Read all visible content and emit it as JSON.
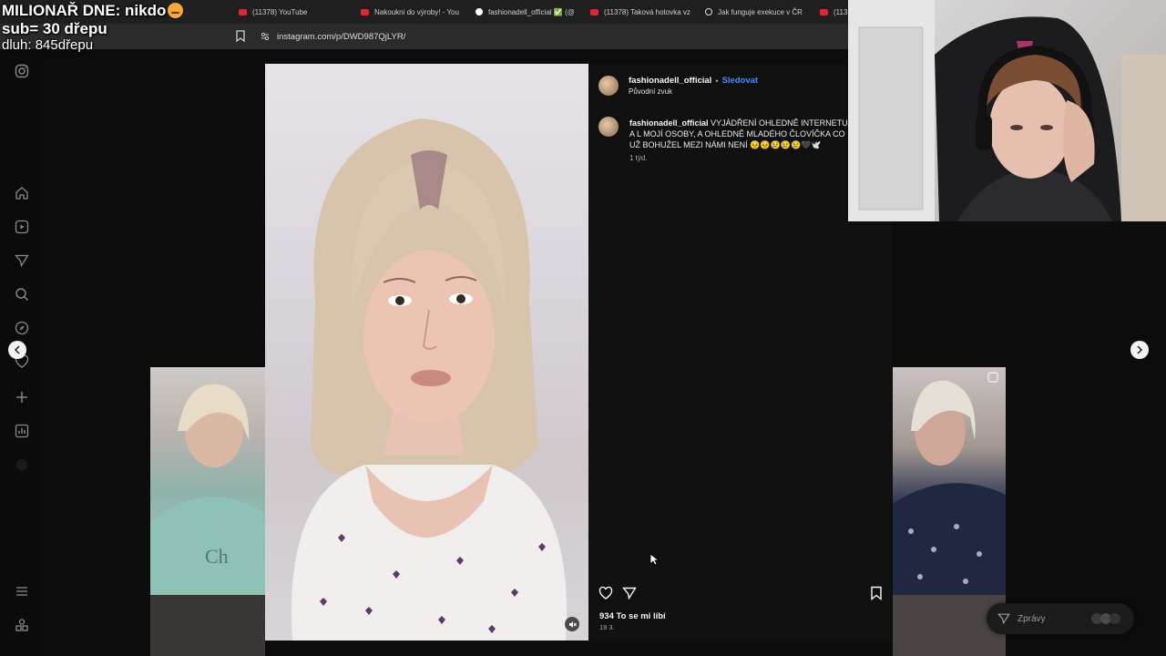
{
  "overlay": {
    "line1": "MILIONAŘ DNE: nikdo",
    "line2": "sub= 30 dřepu",
    "line3": "dluh: 845dřepu"
  },
  "tabs": [
    {
      "label": "(11378) YouTube",
      "icon": "youtube-icon"
    },
    {
      "label": "Nakoukni do výroby! - You",
      "icon": "youtube-icon"
    },
    {
      "label": "fashionadell_official ✅ (@",
      "icon": "tiktok-icon"
    },
    {
      "label": "(11378) Taková hotovka vz",
      "icon": "youtube-icon"
    },
    {
      "label": "Jak funguje exekuce v ČR",
      "icon": "github-icon"
    },
    {
      "label": "(113",
      "icon": "youtube-icon"
    }
  ],
  "address": {
    "url": "instagram.com/p/DWD987QjLYR/"
  },
  "post": {
    "username": "fashionadell_official",
    "separator": "•",
    "follow_label": "Sledovat",
    "audio": "Původní zvuk",
    "caption_user": "fashionadell_official",
    "caption_text": "VYJÁDŘENÍ OHLEDNĚ INTERNETU A L MOJÍ OSOBY, A OHLEDNĚ MLADÉHO ČLOVÍČKA CO UŽ BOHUŽEL MEZI NÁMI NENÍ 😣😣😢😢😢🖤🕊️",
    "caption_time": "1 týd.",
    "likes": "934 To se mi líbí",
    "date": "19 3."
  },
  "messages": {
    "label": "Zprávy"
  },
  "colors": {
    "accent": "#4a8cff",
    "background": "#0c0c0c",
    "panel": "#101010"
  }
}
